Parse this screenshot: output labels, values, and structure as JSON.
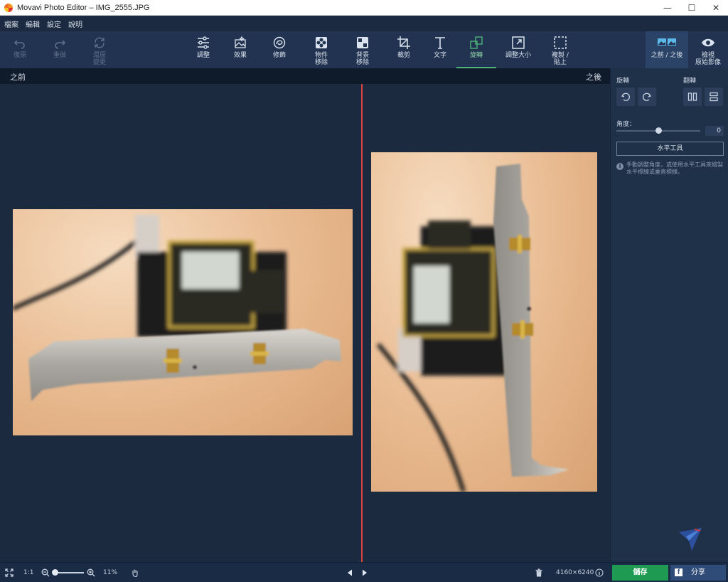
{
  "window": {
    "title": "Movavi Photo Editor – IMG_2555.JPG",
    "minimize": "—",
    "maximize": "☐",
    "close": "✕"
  },
  "menu": [
    "檔案",
    "編輯",
    "設定",
    "說明"
  ],
  "toolbar": {
    "undo": "復原",
    "redo": "重做",
    "revert": "還原\n變更",
    "adjust": "調整",
    "effects": "效果",
    "retouch": "修飾",
    "object_removal": "物件\n移除",
    "background_removal": "背景\n移除",
    "crop": "裁剪",
    "text": "文字",
    "rotate": "旋轉",
    "resize": "調整大小",
    "copy_paste": "複製 /\n貼上",
    "before_after": "之前 / 之後",
    "view_original": "檢視\n原始影像"
  },
  "compare": {
    "before": "之前",
    "after": "之後"
  },
  "panel": {
    "rotate_heading": "旋轉",
    "flip_heading": "翻轉",
    "angle_label": "角度：",
    "angle_value": "0",
    "level_tool": "水平工具",
    "hint": "手動調整角度，或使用水平工具來繪製水平標線或垂直標線。"
  },
  "status": {
    "one_to_one": "1:1",
    "zoom": "11%",
    "dimensions": "4160×6240",
    "save": "儲存",
    "share": "分享"
  },
  "colors": {
    "accent_green": "#1e9a52",
    "divider_red": "#d8443a",
    "active_tool": "#4db378"
  }
}
